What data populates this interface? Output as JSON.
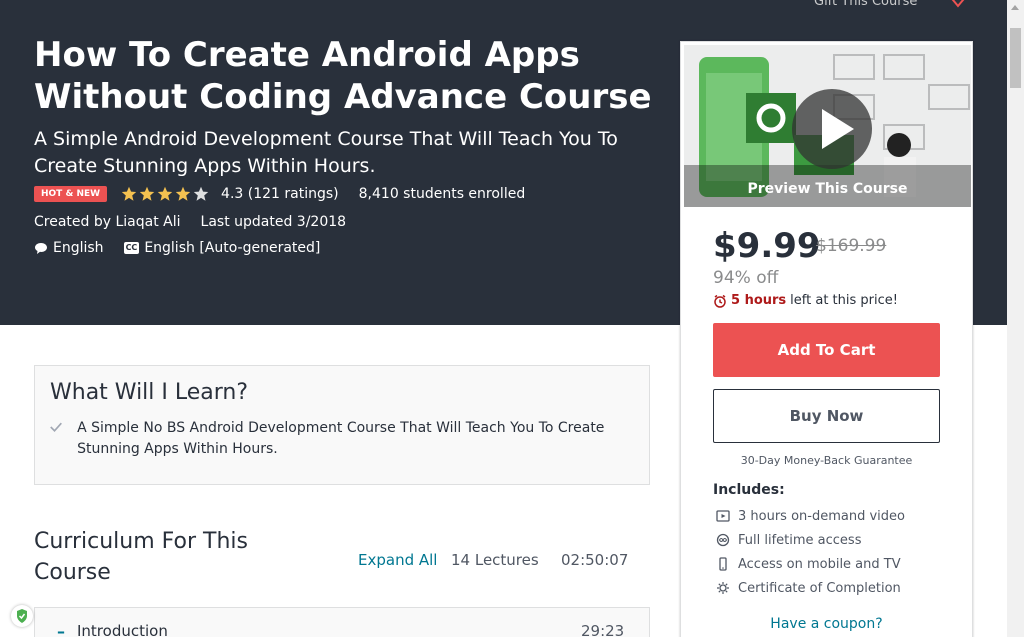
{
  "header": {
    "gift_label": "Gift This Course"
  },
  "course": {
    "title": "How To Create Android Apps Without Coding Advance Course",
    "subtitle": "A Simple Android Development Course That Will Teach You To Create Stunning Apps Within Hours.",
    "badge": "HOT & NEW",
    "rating": "4.3",
    "rating_value": 4.3,
    "rating_max": 5,
    "ratings_count": "(121 ratings)",
    "students": "8,410 students enrolled",
    "created_by": "Created by Liaqat Ali",
    "last_updated": "Last updated 3/2018",
    "language": "English",
    "captions": "English [Auto-generated]",
    "cc_icon_text": "CC"
  },
  "sidebar": {
    "preview_label": "Preview This Course",
    "price": "$9.99",
    "original_price": "$169.99",
    "discount": "94% off",
    "timer_hours": "5 hours",
    "timer_rest": "left at this price!",
    "add_to_cart": "Add To Cart",
    "buy_now": "Buy Now",
    "guarantee": "30-Day Money-Back Guarantee",
    "includes_title": "Includes:",
    "includes": [
      {
        "icon": "video-icon",
        "label": "3 hours on-demand video"
      },
      {
        "icon": "infinity-icon",
        "label": "Full lifetime access"
      },
      {
        "icon": "mobile-icon",
        "label": "Access on mobile and TV"
      },
      {
        "icon": "certificate-icon",
        "label": "Certificate of Completion"
      }
    ],
    "coupon": "Have a coupon?"
  },
  "learn": {
    "title": "What Will I Learn?",
    "items": [
      "A Simple No BS Android Development Course That Will Teach You To Create Stunning Apps Within Hours."
    ]
  },
  "curriculum": {
    "title": "Curriculum For This Course",
    "expand_all": "Expand All",
    "lectures": "14 Lectures",
    "duration": "02:50:07",
    "sections": [
      {
        "toggle": "–",
        "title": "Introduction",
        "time": "29:23"
      }
    ]
  },
  "colors": {
    "hero_bg": "#29303b",
    "accent_red": "#ec5252",
    "link_blue": "#007791",
    "star": "#f4c150"
  }
}
